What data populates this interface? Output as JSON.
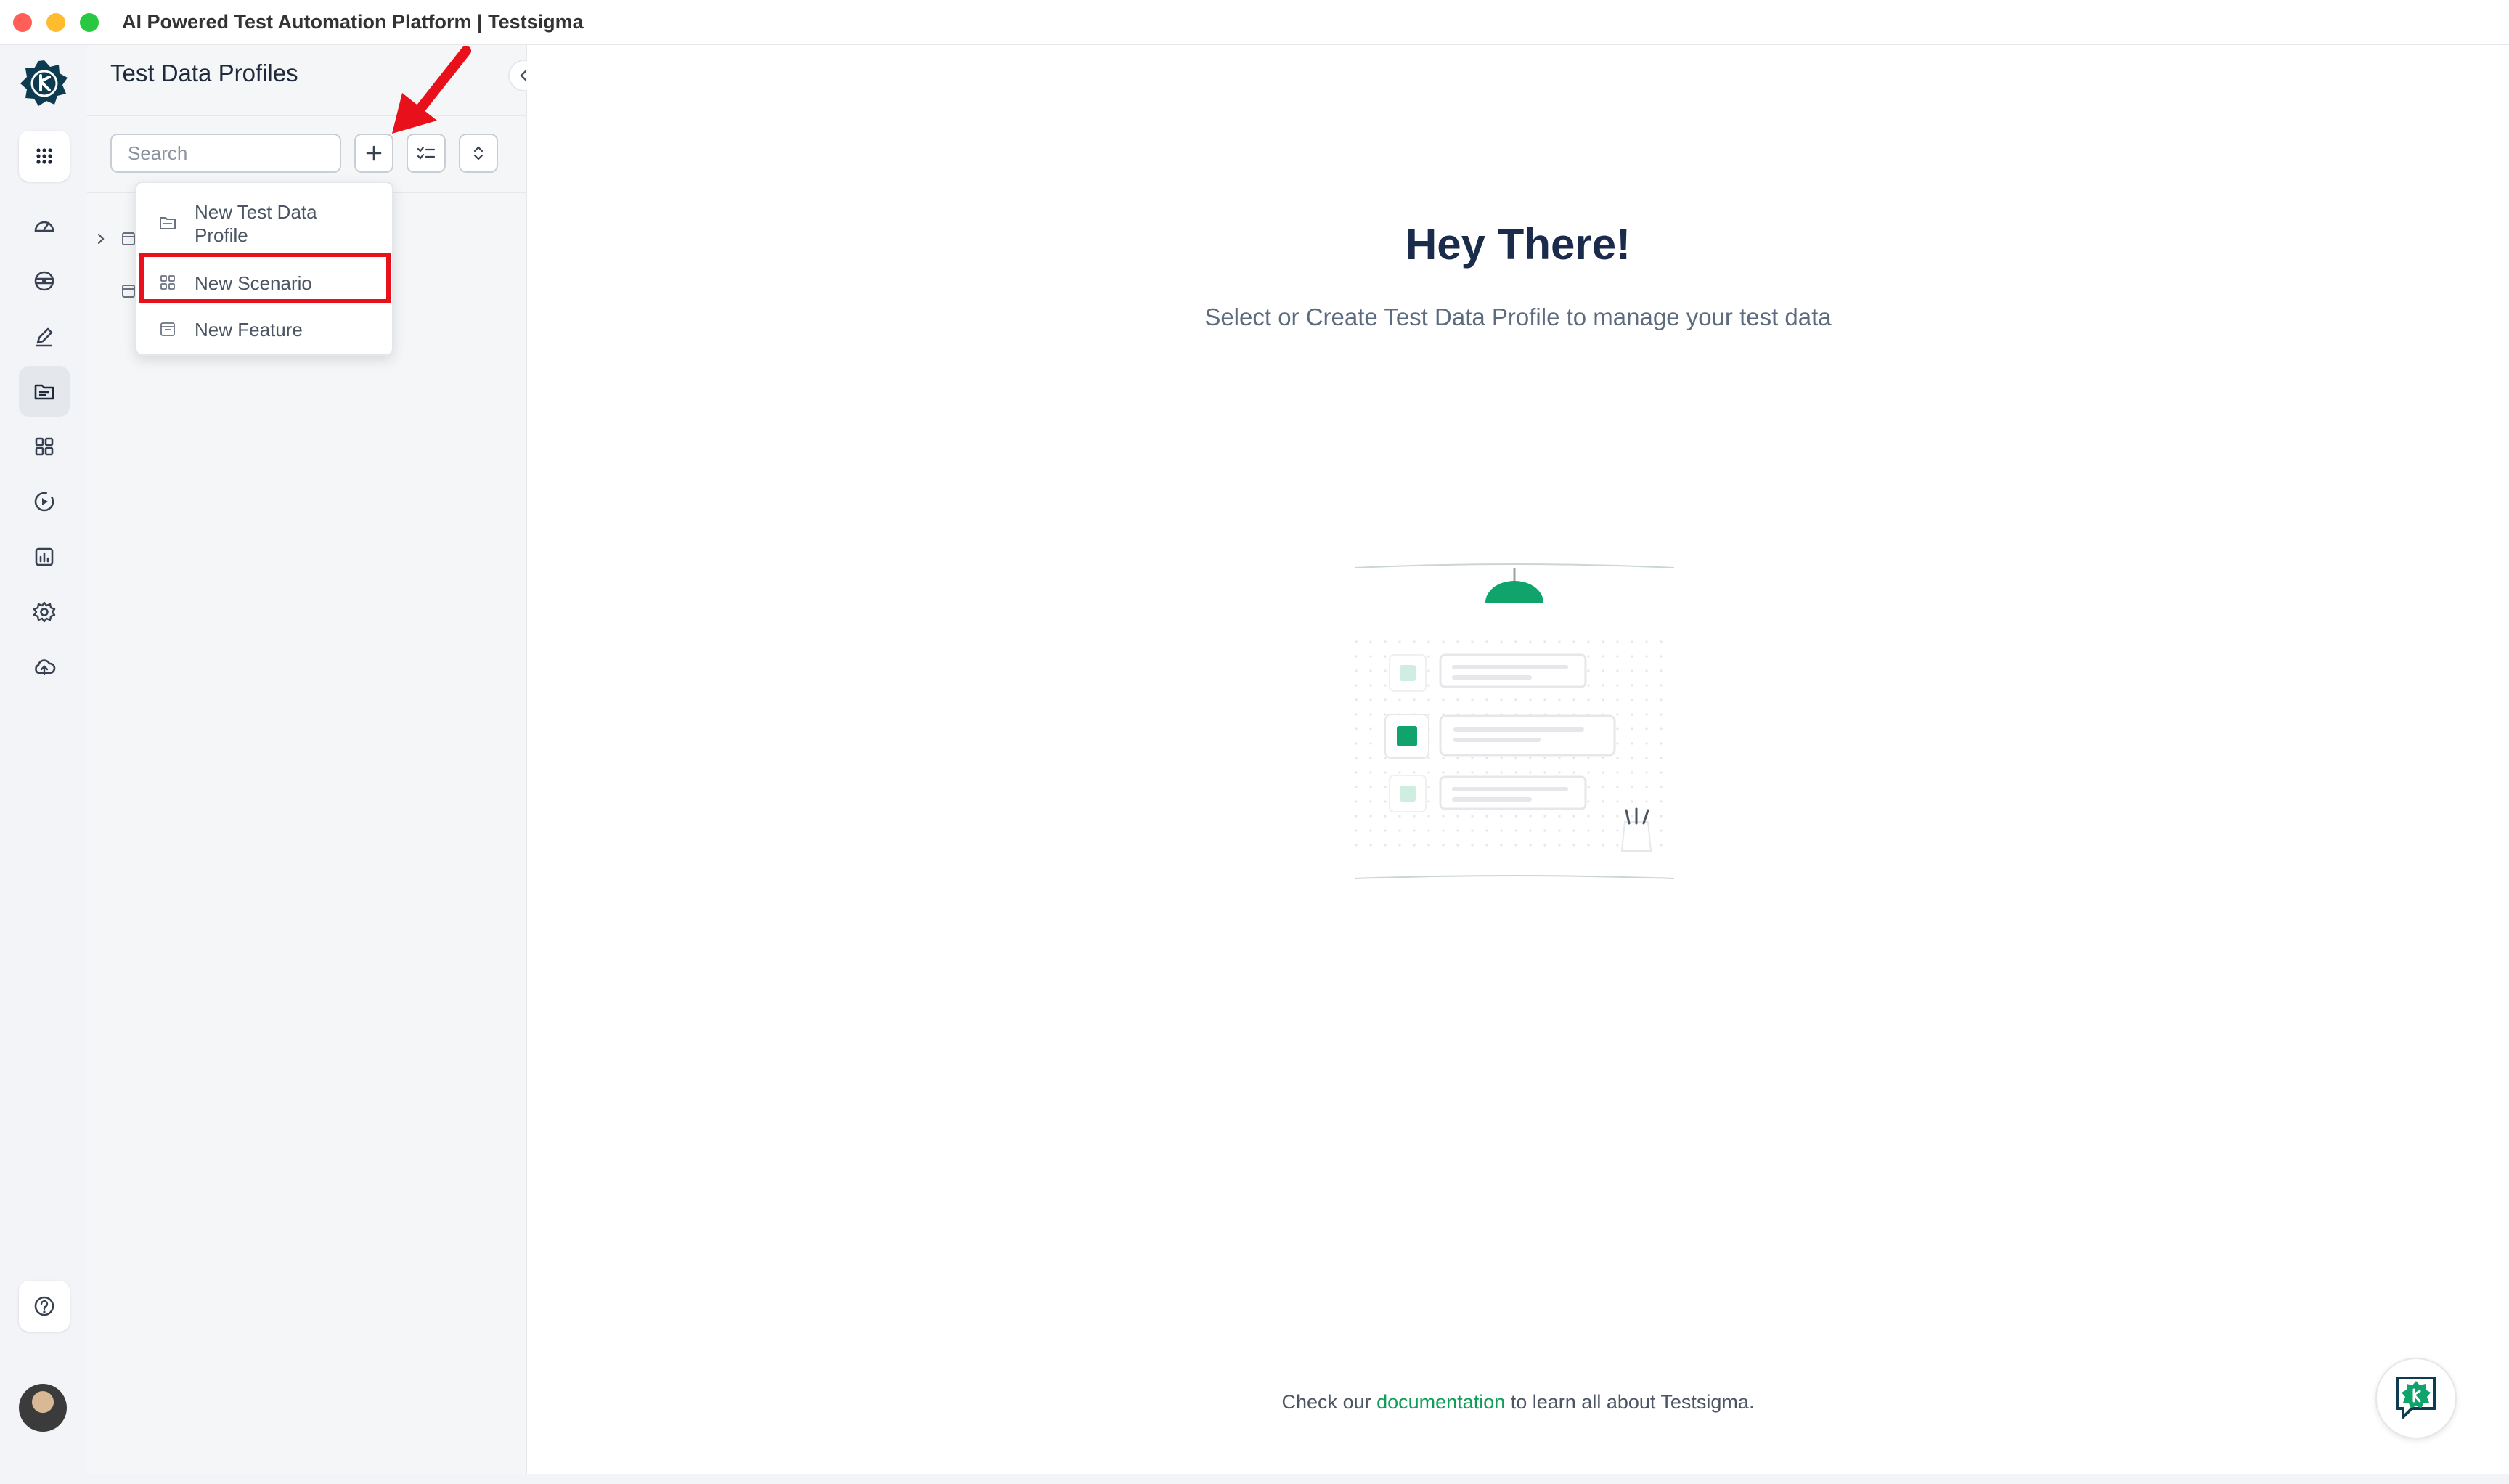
{
  "window": {
    "title": "AI Powered Test Automation Platform | Testsigma"
  },
  "rail": {
    "items": [
      "apps-grid-icon",
      "dashboard-icon",
      "elements-icon",
      "test-cases-icon",
      "test-data-icon",
      "components-icon",
      "run-icon",
      "reports-icon",
      "settings-icon",
      "cloud-upload-icon"
    ],
    "active": "test-data-icon",
    "help_icon": "help-icon"
  },
  "panel": {
    "title": "Test Data Profiles",
    "search": {
      "placeholder": "Search",
      "value": ""
    }
  },
  "dropdown": {
    "items": [
      {
        "label": "New Test Data Profile",
        "icon": "folder-icon"
      },
      {
        "label": "New Scenario",
        "icon": "grid-icon"
      },
      {
        "label": "New Feature",
        "icon": "calendar-icon"
      }
    ],
    "highlighted": "New Scenario"
  },
  "main": {
    "heading": "Hey There!",
    "subheading": "Select or Create Test Data Profile to manage your test data",
    "footer": {
      "prefix": "Check our",
      "link": "documentation",
      "suffix": "to learn all about Testsigma."
    }
  },
  "colors": {
    "brand": "#0d3b4f",
    "accent": "#0f9d58",
    "highlight": "#e8101a"
  }
}
